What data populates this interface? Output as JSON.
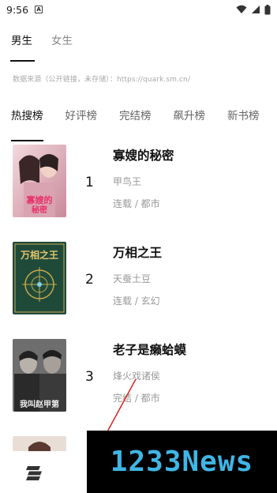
{
  "status": {
    "time": "9:56",
    "notification_letter": "A"
  },
  "gender_tabs": [
    {
      "label": "男生",
      "active": true
    },
    {
      "label": "女生",
      "active": false
    }
  ],
  "source_text": "数据来源（公开链接，未存储）：https://quark.sm.cn/",
  "rank_tabs": [
    {
      "label": "热搜榜",
      "active": true
    },
    {
      "label": "好评榜",
      "active": false
    },
    {
      "label": "完结榜",
      "active": false
    },
    {
      "label": "飙升榜",
      "active": false
    },
    {
      "label": "新书榜",
      "active": false
    }
  ],
  "books": [
    {
      "rank": "1",
      "title": "寡嫂的秘密",
      "author": "甲鸟王",
      "meta": "连载 / 都市",
      "cover_text": "寡嫂的秘密"
    },
    {
      "rank": "2",
      "title": "万相之王",
      "author": "天蚕土豆",
      "meta": "连载 / 玄幻",
      "cover_text": "万相之王"
    },
    {
      "rank": "3",
      "title": "老子是癞蛤蟆",
      "author": "烽火戏诸侯",
      "meta": "完结 / 都市",
      "cover_text": "我叫赵甲第"
    }
  ],
  "watermark": {
    "text": "1233News"
  },
  "colors": {
    "accent": "#111111",
    "muted": "#999999",
    "watermark": "#3fb6e6"
  }
}
